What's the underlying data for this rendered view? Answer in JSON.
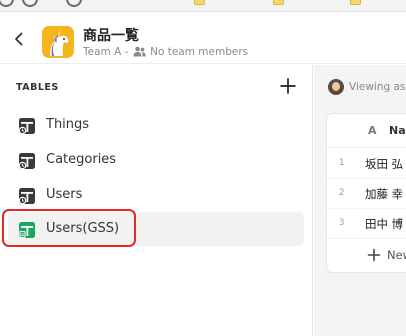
{
  "header": {
    "app_title": "商品一覧",
    "team_name": "Team A",
    "separator": "-",
    "members_text": "No team members"
  },
  "sidebar": {
    "heading": "TABLES",
    "tables": [
      {
        "label": "Things",
        "icon": "table-icon"
      },
      {
        "label": "Categories",
        "icon": "table-icon"
      },
      {
        "label": "Users",
        "icon": "table-icon"
      },
      {
        "label": "Users(GSS)",
        "icon": "google-sheets-table-icon",
        "selected": true
      }
    ]
  },
  "viewer": {
    "viewing_text": "Viewing as"
  },
  "grid": {
    "column_type": "A",
    "column_name": "Na",
    "rows": [
      {
        "num": "1",
        "value": "坂田 弘"
      },
      {
        "num": "2",
        "value": "加藤 幸"
      },
      {
        "num": "3",
        "value": "田中 博"
      }
    ],
    "new_row_label": "New"
  },
  "colors": {
    "accent_highlight": "#e02a2a",
    "app_icon_bg": "#f5b51e",
    "sheets_green": "#20a464"
  }
}
